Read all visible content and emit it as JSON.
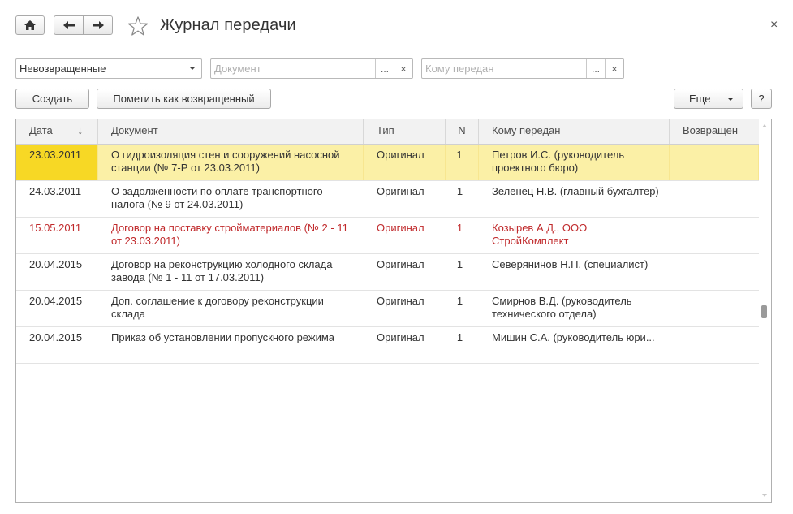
{
  "window": {
    "title": "Журнал передачи",
    "close": "×"
  },
  "filters": {
    "status_value": "Невозвращенные",
    "document_placeholder": "Документ",
    "recipient_placeholder": "Кому передан",
    "select_button": "...",
    "clear_button": "×"
  },
  "toolbar": {
    "create_label": "Создать",
    "mark_returned_label": "Пометить как возвращенный",
    "more_label": "Еще",
    "help_label": "?"
  },
  "table": {
    "columns": [
      "Дата",
      "Документ",
      "Тип",
      "N",
      "Кому передан",
      "Возвращен"
    ],
    "sort_indicator": "↓",
    "rows": [
      {
        "date": "23.03.2011",
        "document": "О гидроизоляция стен и сооружений насосной станции (№ 7-Р от 23.03.2011)",
        "type": "Оригинал",
        "n": "1",
        "recipient": "Петров И.С. (руководитель проектного бюро)",
        "returned": ""
      },
      {
        "date": "24.03.2011",
        "document": "О задолженности по оплате транспортного налога (№ 9 от 24.03.2011)",
        "type": "Оригинал",
        "n": "1",
        "recipient": "Зеленец Н.В. (главный бухгалтер)",
        "returned": ""
      },
      {
        "date": "15.05.2011",
        "document": "Договор на поставку стройматериалов (№ 2 - 11 от 23.03.2011)",
        "type": "Оригинал",
        "n": "1",
        "recipient": "Козырев А.Д., ООО СтройКомплект",
        "returned": ""
      },
      {
        "date": "20.04.2015",
        "document": "Договор на реконструкцию холодного склада завода (№ 1 - 11 от 17.03.2011)",
        "type": "Оригинал",
        "n": "1",
        "recipient": "Северянинов Н.П. (специалист)",
        "returned": ""
      },
      {
        "date": "20.04.2015",
        "document": "Доп. соглашение к договору реконструкции склада",
        "type": "Оригинал",
        "n": "1",
        "recipient": "Смирнов В.Д. (руководитель технического отдела)",
        "returned": ""
      },
      {
        "date": "20.04.2015",
        "document": "Приказ об установлении пропускного режима",
        "type": "Оригинал",
        "n": "1",
        "recipient": "Мишин С.А. (руководитель юри...",
        "returned": ""
      }
    ]
  },
  "colors": {
    "selected_row": "#fbf0a6",
    "selected_cell": "#f7d825",
    "overdue_text": "#c0292b"
  },
  "icons": [
    "home-icon",
    "back-arrow-icon",
    "forward-arrow-icon",
    "star-icon",
    "dropdown-arrow-icon",
    "close-icon"
  ]
}
